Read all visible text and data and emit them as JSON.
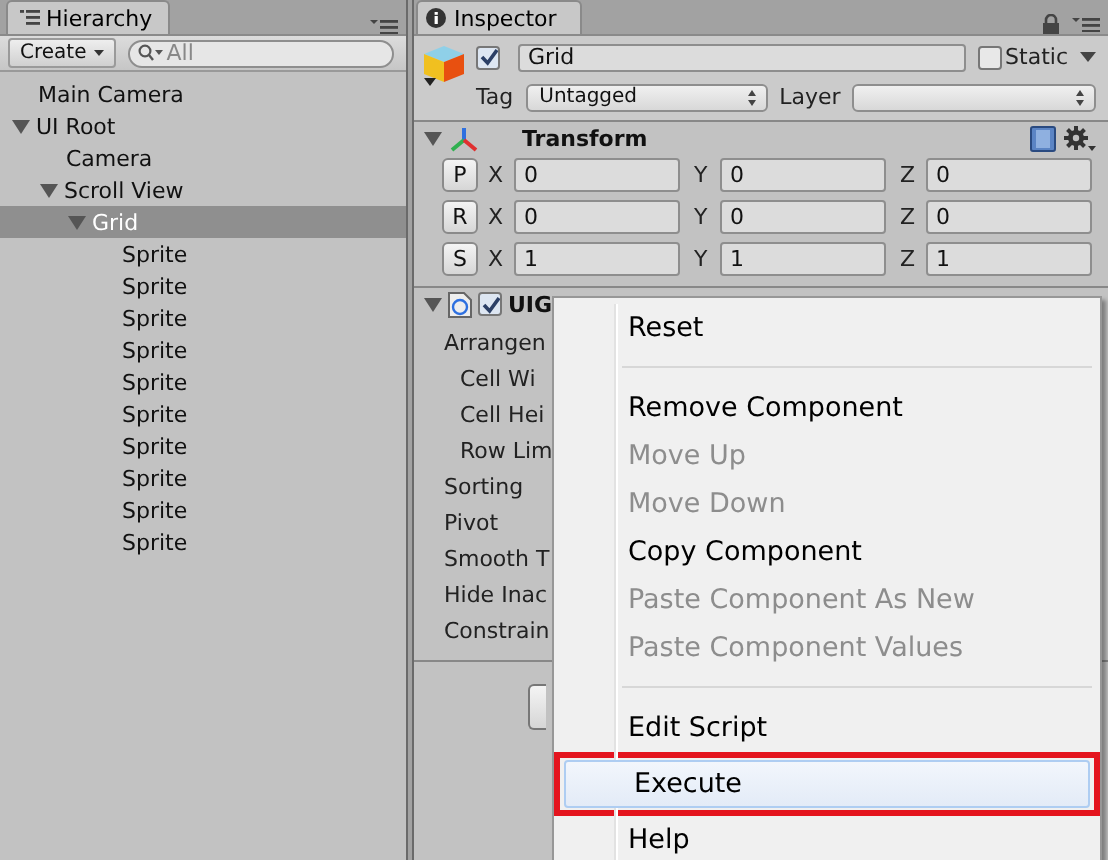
{
  "hierarchy": {
    "title": "Hierarchy",
    "create_button": "Create",
    "search": {
      "placeholder": "All"
    },
    "items": [
      {
        "label": "Main Camera",
        "selected": false
      },
      {
        "label": "UI Root",
        "expanded": true,
        "selected": false,
        "children": [
          {
            "label": "Camera",
            "selected": false
          },
          {
            "label": "Scroll View",
            "expanded": true,
            "selected": false,
            "children": [
              {
                "label": "Grid",
                "expanded": true,
                "selected": true,
                "children": [
                  {
                    "label": "Sprite",
                    "selected": false
                  },
                  {
                    "label": "Sprite",
                    "selected": false
                  },
                  {
                    "label": "Sprite",
                    "selected": false
                  },
                  {
                    "label": "Sprite",
                    "selected": false
                  },
                  {
                    "label": "Sprite",
                    "selected": false
                  },
                  {
                    "label": "Sprite",
                    "selected": false
                  },
                  {
                    "label": "Sprite",
                    "selected": false
                  },
                  {
                    "label": "Sprite",
                    "selected": false
                  },
                  {
                    "label": "Sprite",
                    "selected": false
                  },
                  {
                    "label": "Sprite",
                    "selected": false
                  }
                ]
              }
            ]
          }
        ]
      }
    ]
  },
  "inspector": {
    "title": "Inspector",
    "object": {
      "active": true,
      "name": "Grid",
      "static": false,
      "static_label": "Static",
      "tag_label": "Tag",
      "tag": "Untagged",
      "layer_label": "Layer"
    },
    "transform": {
      "title": "Transform",
      "expanded": true,
      "rows": [
        {
          "button": "P",
          "fields": [
            {
              "axis": "X",
              "value": "0"
            },
            {
              "axis": "Y",
              "value": "0"
            },
            {
              "axis": "Z",
              "value": "0"
            }
          ]
        },
        {
          "button": "R",
          "fields": [
            {
              "axis": "X",
              "value": "0"
            },
            {
              "axis": "Y",
              "value": "0"
            },
            {
              "axis": "Z",
              "value": "0"
            }
          ]
        },
        {
          "button": "S",
          "fields": [
            {
              "axis": "X",
              "value": "1"
            },
            {
              "axis": "Y",
              "value": "1"
            },
            {
              "axis": "Z",
              "value": "1"
            }
          ]
        }
      ]
    },
    "component": {
      "title": "UIG",
      "enabled": true,
      "expanded": true,
      "properties": [
        {
          "label": "Arrangen",
          "children": [
            {
              "label": "Cell Wi"
            },
            {
              "label": "Cell Hei"
            },
            {
              "label": "Row Lim"
            }
          ]
        },
        {
          "label": "Sorting"
        },
        {
          "label": "Pivot"
        },
        {
          "label": "Smooth T"
        },
        {
          "label": "Hide Inac"
        },
        {
          "label": "Constrain"
        }
      ]
    }
  },
  "context_menu": [
    {
      "kind": "item",
      "label": "Reset",
      "disabled": false,
      "selected": false,
      "marked": false
    },
    {
      "kind": "separator"
    },
    {
      "kind": "item",
      "label": "Remove Component",
      "disabled": false,
      "selected": false,
      "marked": false
    },
    {
      "kind": "item",
      "label": "Move Up",
      "disabled": true,
      "selected": false,
      "marked": false
    },
    {
      "kind": "item",
      "label": "Move Down",
      "disabled": true,
      "selected": false,
      "marked": false
    },
    {
      "kind": "item",
      "label": "Copy Component",
      "disabled": false,
      "selected": false,
      "marked": false
    },
    {
      "kind": "item",
      "label": "Paste Component As New",
      "disabled": true,
      "selected": false,
      "marked": false
    },
    {
      "kind": "item",
      "label": "Paste Component Values",
      "disabled": true,
      "selected": false,
      "marked": false
    },
    {
      "kind": "separator"
    },
    {
      "kind": "item",
      "label": "Edit Script",
      "disabled": false,
      "selected": false,
      "marked": false
    },
    {
      "kind": "item",
      "label": "Execute",
      "disabled": false,
      "selected": true,
      "marked": true
    },
    {
      "kind": "item",
      "label": "Help",
      "disabled": false,
      "selected": false,
      "marked": false
    }
  ]
}
